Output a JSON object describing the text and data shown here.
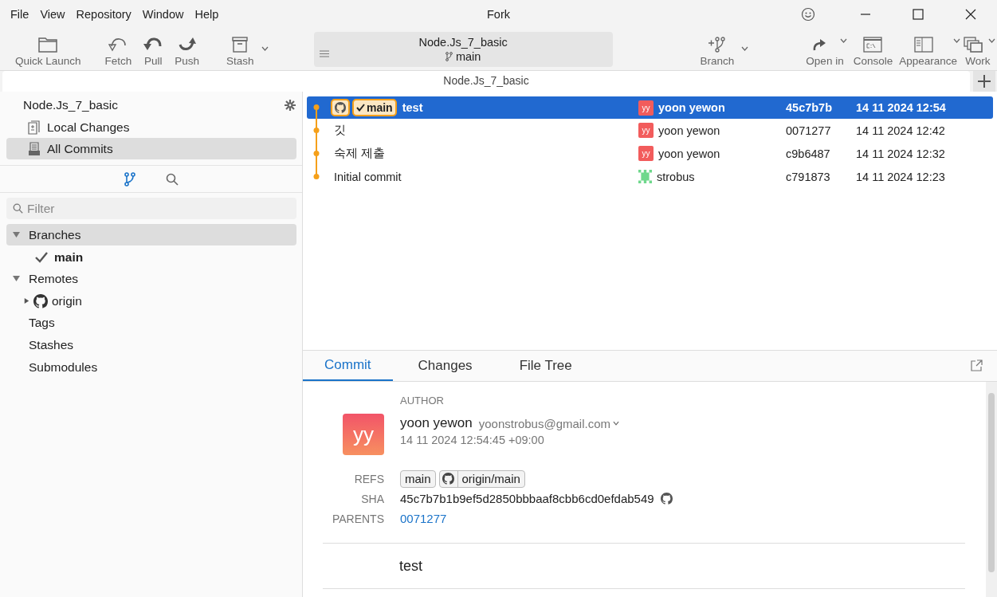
{
  "menu": [
    "File",
    "View",
    "Repository",
    "Window",
    "Help"
  ],
  "window": {
    "title": "Fork"
  },
  "toolbar_left": [
    {
      "kind": "folder",
      "label": "Quick Launch",
      "has_menu": false
    },
    {
      "kind": "fetch",
      "label": "Fetch",
      "has_menu": false
    },
    {
      "kind": "pull",
      "label": "Pull",
      "has_menu": false
    },
    {
      "kind": "push",
      "label": "Push",
      "has_menu": false
    },
    {
      "kind": "stash",
      "label": "Stash",
      "has_menu": true
    }
  ],
  "repo_switcher": {
    "name": "Node.Js_7_basic",
    "branch": "main"
  },
  "toolbar_right": [
    {
      "kind": "branch",
      "label": "Branch",
      "has_menu": true
    },
    {
      "kind": "openin",
      "label": "Open in",
      "has_menu": true
    },
    {
      "kind": "console",
      "label": "Console",
      "has_menu": false
    },
    {
      "kind": "appearance",
      "label": "Appearance",
      "has_menu": true
    },
    {
      "kind": "windows",
      "label": "Work",
      "has_menu": true
    }
  ],
  "repo_tabs": [
    {
      "label": "Node.Js_7_basic",
      "selected": true
    }
  ],
  "sidebar": {
    "repo_name": "Node.Js_7_basic",
    "items": [
      {
        "kind": "local",
        "label": "Local Changes",
        "selected": false
      },
      {
        "kind": "commits",
        "label": "All Commits",
        "selected": true
      }
    ],
    "panel_tabs": [
      {
        "kind": "branches",
        "selected": true
      },
      {
        "kind": "search",
        "selected": false
      }
    ],
    "filter": {
      "placeholder": "Filter"
    },
    "tree": [
      {
        "label": "Branches",
        "expanded": true,
        "selected": true,
        "children": [
          {
            "label": "main",
            "current": true
          }
        ]
      },
      {
        "label": "Remotes",
        "expanded": true,
        "selected": false,
        "children": [
          {
            "label": "origin",
            "expanded": false,
            "kind": "github"
          }
        ]
      },
      {
        "label": "Tags",
        "selected": false
      },
      {
        "label": "Stashes",
        "selected": false
      },
      {
        "label": "Submodules",
        "selected": false
      }
    ]
  },
  "commits": [
    {
      "subject": "test",
      "refs": [
        {
          "kind": "remote"
        },
        {
          "kind": "local",
          "label": "main",
          "current": true
        }
      ],
      "author": "yoon yewon",
      "avatar": {
        "initials": "yy",
        "color": "#f25c5c"
      },
      "hash": "45c7b7b",
      "date": "14 11 2024 12:54",
      "selected": true
    },
    {
      "subject": "깃",
      "author": "yoon yewon",
      "avatar": {
        "initials": "yy",
        "color": "#f25c5c"
      },
      "hash": "0071277",
      "date": "14 11 2024 12:42",
      "selected": false
    },
    {
      "subject": "숙제 제출",
      "author": "yoon yewon",
      "avatar": {
        "initials": "yy",
        "color": "#f25c5c"
      },
      "hash": "c9b6487",
      "date": "14 11 2024 12:32",
      "selected": false
    },
    {
      "subject": "Initial commit",
      "author": "strobus",
      "avatar": {
        "color": "#6fd88c"
      },
      "hash": "c791873",
      "date": "14 11 2024 12:23",
      "selected": false
    }
  ],
  "detail_tabs": [
    {
      "label": "Commit",
      "selected": true
    },
    {
      "label": "Changes",
      "selected": false
    },
    {
      "label": "File Tree",
      "selected": false
    }
  ],
  "details": {
    "author_label": "AUTHOR",
    "avatar": "yy",
    "author_name": "yoon yewon",
    "email": "yoonstrobus@gmail.com",
    "date": "14 11 2024 12:54:45 +09:00",
    "refs_label": "REFS",
    "refs": [
      {
        "kind": "local",
        "label": "main"
      },
      {
        "kind": "remote",
        "label": "origin/main"
      }
    ],
    "sha_label": "SHA",
    "sha": "45c7b7b1b9ef5d2850bbbaaf8cbb6cd0efdab549",
    "parents_label": "PARENTS",
    "parents": [
      "0071277"
    ],
    "message": "test"
  }
}
